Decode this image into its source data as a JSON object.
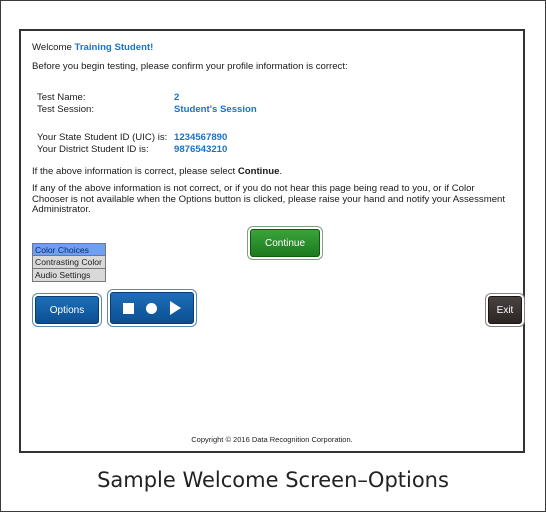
{
  "welcome": {
    "prefix": "Welcome ",
    "name": "Training Student!"
  },
  "instruction": "Before you begin testing, please confirm your profile information is correct:",
  "fields": {
    "test_name_label": "Test Name:",
    "test_name_value": "2",
    "test_session_label": "Test Session:",
    "test_session_value": "Student's Session",
    "state_id_label": "Your State Student ID (UIC) is:",
    "state_id_value": "1234567890",
    "district_id_label": "Your District Student ID is:",
    "district_id_value": "9876543210"
  },
  "confirm": {
    "prefix": "If the above information is correct, please select ",
    "bold": "Continue",
    "suffix": "."
  },
  "incorrect_notice": "If any of the above information is not correct, or if you do not hear this page being read to you, or if Color Chooser is not available when the Options button is clicked, please raise your hand and notify your Assessment Administrator.",
  "buttons": {
    "continue": "Continue",
    "options": "Options",
    "exit": "Exit"
  },
  "options_menu": [
    "Color Choices",
    "Contrasting Color",
    "Audio Settings"
  ],
  "media_controls": {
    "stop": "stop-icon",
    "record": "circle-icon",
    "play": "play-icon"
  },
  "copyright": "Copyright © 2016 Data Recognition Corporation.",
  "caption": "Sample Welcome Screen–Options",
  "colors": {
    "accent_blue": "#1a73c7",
    "continue_green": "#2a8f2a",
    "options_blue": "#0b4f92",
    "exit_dark": "#2c2523",
    "menu_highlight": "#6e9ff2"
  }
}
